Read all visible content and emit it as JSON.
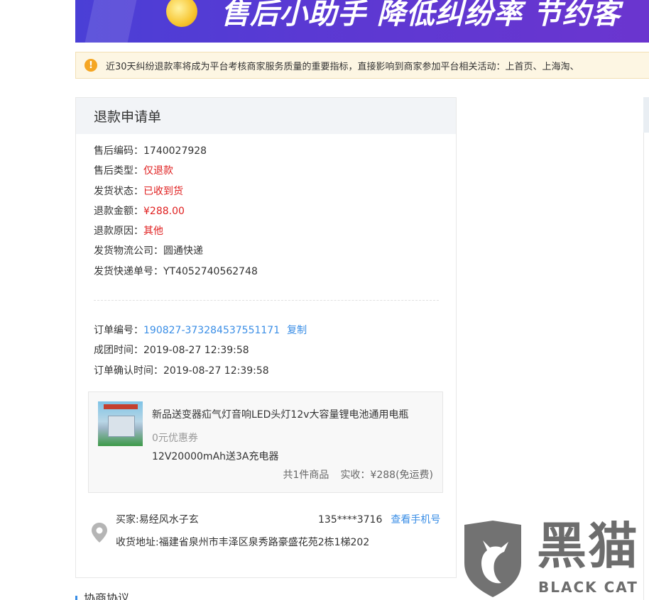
{
  "banner": {
    "text": "售后小助手  降低纠纷率  节约客"
  },
  "notice": {
    "icon": "warning-icon",
    "text": "近30天纠纷退款率将成为平台考核商家服务质量的重要指标，直接影响到商家参加平台相关活动：上首页、上海淘、"
  },
  "refund": {
    "title": "退款申请单",
    "rows": [
      {
        "label": "售后编码：",
        "value": "1740027928"
      },
      {
        "label": "售后类型：",
        "value": "仅退款"
      },
      {
        "label": "发货状态：",
        "value": "已收到货"
      },
      {
        "label": "退款金额：",
        "value": "¥288.00"
      },
      {
        "label": "退款原因：",
        "value": "其他"
      },
      {
        "label": "发货物流公司：",
        "value": "圆通快递"
      },
      {
        "label": "发货快递单号：",
        "value": "YT4052740562748"
      }
    ]
  },
  "order": {
    "number_label": "订单编号：",
    "number": "190827-373284537551171",
    "copy_label": "复制",
    "group_time_label": "成团时间：",
    "group_time": "2019-08-27 12:39:58",
    "confirm_time_label": "订单确认时间：",
    "confirm_time": "2019-08-27 12:39:58"
  },
  "product": {
    "title": "新品送变器疝气灯音响LED头灯12v大容量锂电池通用电瓶",
    "coupon": "0元优惠券",
    "spec": "12V20000mAh送3A充电器",
    "count": "共1件商品",
    "paid": "实收：¥288(免运费)"
  },
  "buyer": {
    "name": "买家:易经风水子玄",
    "phone": "135****3716",
    "view_phone_label": "查看手机号",
    "address": "收货地址:福建省泉州市丰泽区泉秀路豪盛花苑2栋1梯202"
  },
  "section_below": {
    "title": "协商协议"
  },
  "watermark": {
    "big": "黑猫",
    "small": "BLACK CAT"
  },
  "colors": {
    "red": "#e02020",
    "blue": "#3a8ee6",
    "notice_bg": "#fdf6e3",
    "banner": "#5a39d3"
  }
}
